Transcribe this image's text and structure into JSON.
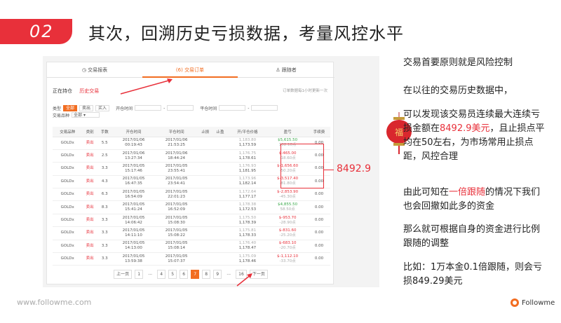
{
  "header": {
    "number": "02",
    "title": "其次，回溯历史亏损数据，考量风控水平"
  },
  "tabs": [
    "交易报表",
    "(6) 交易订单",
    "跟随者"
  ],
  "subtabs": {
    "open": "正在持仓",
    "history": "历史交易"
  },
  "order_info": "订单数据每1小时更新一次",
  "filters": {
    "direction_label": "类型",
    "direction_options": [
      "全部",
      "卖出",
      "买入"
    ],
    "open_time_label": "开仓时间",
    "close_time_label": "平仓时间",
    "symbol_label": "交易品种",
    "symbol_value": "全部"
  },
  "table": {
    "headers": [
      "交易品种",
      "类别",
      "手数",
      "开仓时间",
      "平仓时间",
      "止损",
      "止盈",
      "开/平仓价格",
      "盈亏",
      "手续费"
    ],
    "rows": [
      {
        "symbol": "GOLDx",
        "type": "卖出",
        "lots": "5.5",
        "open": "2017/01/06",
        "open_t": "00:19:43",
        "close": "2017/01/06",
        "close_t": "21:53:25",
        "p1": "1,183.80",
        "p2": "1,173.59",
        "pnl": "$5,615.50",
        "pnl2": "102.10点",
        "sign": "pos",
        "fee": "0.00"
      },
      {
        "symbol": "GOLDx",
        "type": "卖出",
        "lots": "2.5",
        "open": "2017/01/06",
        "open_t": "13:27:34",
        "close": "2017/01/06",
        "close_t": "18:44:24",
        "p1": "1,176.75",
        "p2": "1,178.61",
        "pnl": "$-465.00",
        "pnl2": "-18.60点",
        "sign": "neg",
        "fee": "0.00"
      },
      {
        "symbol": "GOLDx",
        "type": "卖出",
        "lots": "3.3",
        "open": "2017/01/05",
        "open_t": "15:17:46",
        "close": "2017/01/05",
        "close_t": "23:55:41",
        "p1": "1,176.93",
        "p2": "1,181.95",
        "pnl": "$-1,656.60",
        "pnl2": "-50.20点",
        "sign": "neg",
        "fee": "0.00"
      },
      {
        "symbol": "GOLDx",
        "type": "卖出",
        "lots": "4.3",
        "open": "2017/01/05",
        "open_t": "16:47:35",
        "close": "2017/01/05",
        "close_t": "23:54:41",
        "p1": "1,173.96",
        "p2": "1,182.14",
        "pnl": "$-3,517.40",
        "pnl2": "-81.80点",
        "sign": "neg",
        "fee": "0.00"
      },
      {
        "symbol": "GOLDx",
        "type": "卖出",
        "lots": "6.3",
        "open": "2017/01/05",
        "open_t": "16:54:09",
        "close": "2017/01/05",
        "close_t": "22:01:23",
        "p1": "1,172.64",
        "p2": "1,177.17",
        "pnl": "$-2,853.90",
        "pnl2": "-45.30点",
        "sign": "neg",
        "fee": "0.00"
      },
      {
        "symbol": "GOLDx",
        "type": "卖出",
        "lots": "8.3",
        "open": "2017/01/05",
        "open_t": "15:41:24",
        "close": "2017/01/05",
        "close_t": "16:52:09",
        "p1": "1,178.38",
        "p2": "1,172.53",
        "pnl": "$4,855.50",
        "pnl2": "58.50点",
        "sign": "pos",
        "fee": "0.00"
      },
      {
        "symbol": "GOLDx",
        "type": "卖出",
        "lots": "3.3",
        "open": "2017/01/05",
        "open_t": "14:06:42",
        "close": "2017/01/05",
        "close_t": "15:08:30",
        "p1": "1,175.50",
        "p2": "1,178.39",
        "pnl": "$-953.70",
        "pnl2": "-28.90点",
        "sign": "neg",
        "fee": "0.00"
      },
      {
        "symbol": "GOLDx",
        "type": "卖出",
        "lots": "3.3",
        "open": "2017/01/05",
        "open_t": "14:11:10",
        "close": "2017/01/05",
        "close_t": "15:08:22",
        "p1": "1,175.81",
        "p2": "1,178.33",
        "pnl": "$-831.60",
        "pnl2": "-25.20点",
        "sign": "neg",
        "fee": "0.00"
      },
      {
        "symbol": "GOLDx",
        "type": "卖出",
        "lots": "3.3",
        "open": "2017/01/05",
        "open_t": "14:13:00",
        "close": "2017/01/05",
        "close_t": "15:08:14",
        "p1": "1,176.40",
        "p2": "1,178.47",
        "pnl": "$-683.10",
        "pnl2": "-20.70点",
        "sign": "neg",
        "fee": "0.00"
      },
      {
        "symbol": "GOLDx",
        "type": "卖出",
        "lots": "3.3",
        "open": "2017/01/05",
        "open_t": "13:59:38",
        "close": "2017/01/05",
        "close_t": "15:07:37",
        "p1": "1,175.09",
        "p2": "1,178.46",
        "pnl": "$-1,112.10",
        "pnl2": "-33.70点",
        "sign": "neg",
        "fee": "0.00"
      }
    ]
  },
  "pager": {
    "prev": "上一页",
    "next": "下一页",
    "pages": [
      "1",
      "...",
      "4",
      "5",
      "6",
      "7",
      "8",
      "9",
      "...",
      "16"
    ],
    "current": "7"
  },
  "callout": "8492.9",
  "lantern_char": "福",
  "right": {
    "p1": "交易首要原则就是风险控制",
    "p2": "在以往的交易历史数据中，",
    "p3a": "可以发现该交易员连续最大连续亏损金额在",
    "p3b": "8492.9美元",
    "p3c": "，且止损点平均在50左右，为市场常用止损点距，风控合理",
    "p4a": "由此可知在",
    "p4b": "一倍跟随",
    "p4c": "的情况下我们也会回撤如此多的资金",
    "p5": "那么就可根据自身的资金进行比例跟随的调整",
    "p6": "比如：1万本金0.1倍跟随，则会亏损849.29美元"
  },
  "footer": {
    "site": "www.followme.com",
    "brand": "Followme"
  },
  "colors": {
    "accent_red": "#e8303a",
    "orange": "#f26d21"
  }
}
